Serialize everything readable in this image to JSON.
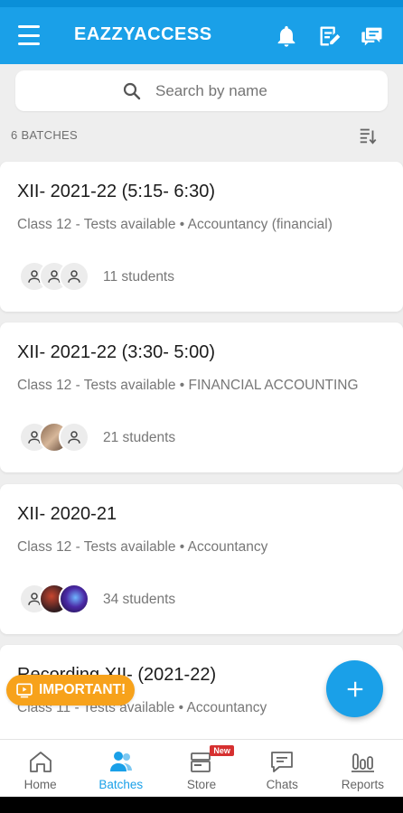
{
  "app": {
    "title": "EAZZYACCESS"
  },
  "search": {
    "placeholder": "Search by name"
  },
  "batches_count": "6 BATCHES",
  "batches": [
    {
      "title": "XII- 2021-22 (5:15- 6:30)",
      "subtitle": "Class 12 - Tests available • Accountancy (financial)",
      "students": "11 students"
    },
    {
      "title": "XII- 2021-22 (3:30- 5:00)",
      "subtitle": "Class 12 - Tests available • FINANCIAL ACCOUNTING",
      "students": "21 students"
    },
    {
      "title": "XII- 2020-21",
      "subtitle": "Class 12 - Tests available • Accountancy",
      "students": "34 students"
    },
    {
      "title": "Recording XII- (2021-22)",
      "subtitle": "Class 11 - Tests available • Accountancy",
      "students": ""
    }
  ],
  "important_label": "IMPORTANT!",
  "nav": {
    "home": "Home",
    "batches": "Batches",
    "store": "Store",
    "store_badge": "New",
    "chats": "Chats",
    "reports": "Reports"
  },
  "colors": {
    "primary": "#1aa0e8",
    "important": "#f7a21b",
    "badge": "#d63030"
  }
}
